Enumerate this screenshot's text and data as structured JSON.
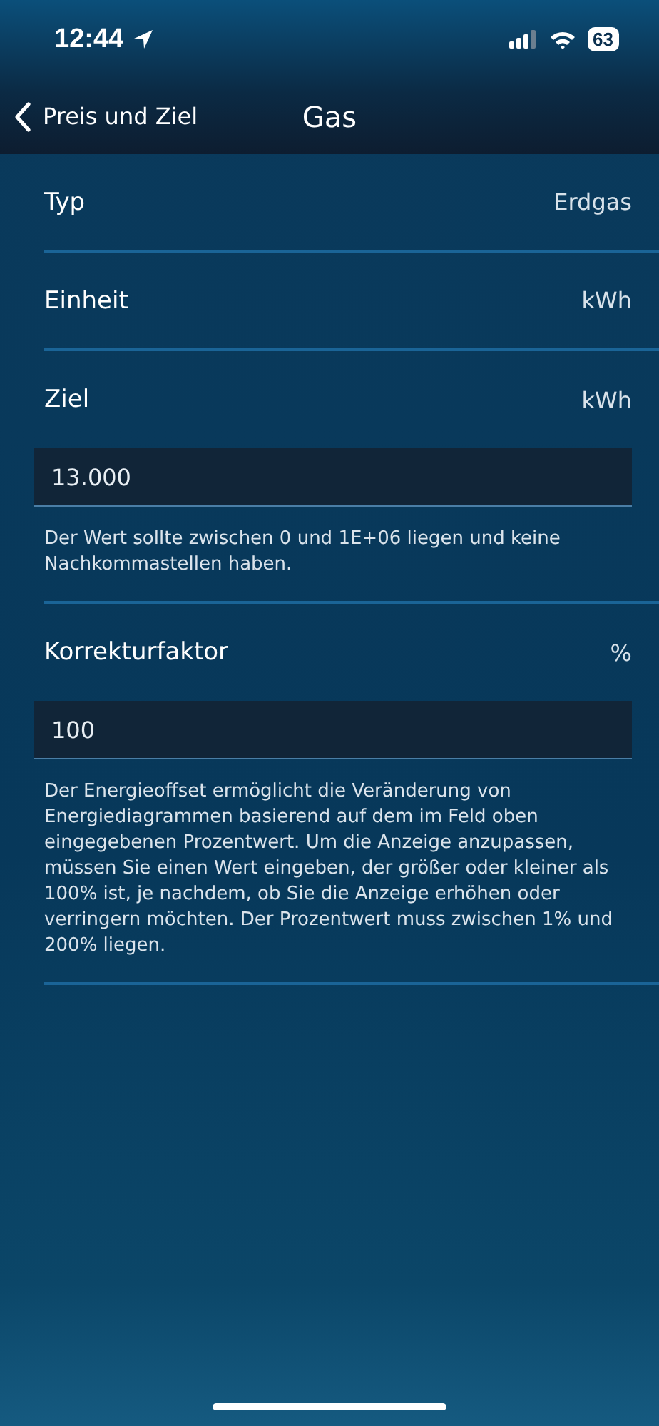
{
  "status_bar": {
    "time": "12:44",
    "battery": "63"
  },
  "nav": {
    "back": "Preis und Ziel",
    "title": "Gas"
  },
  "rows": [
    {
      "kind": "value",
      "label": "Typ",
      "value": "Erdgas"
    },
    {
      "kind": "value",
      "label": "Einheit",
      "value": "kWh"
    },
    {
      "kind": "input",
      "label": "Ziel",
      "unit": "kWh",
      "value": "13.000",
      "hint": "Der Wert sollte zwischen 0 und 1E+06 liegen und keine Nachkommastellen haben."
    },
    {
      "kind": "input",
      "label": "Korrekturfaktor",
      "unit": "%",
      "value": "100",
      "hint": "Der Energieoffset ermöglicht die Veränderung von Energiediagrammen basierend auf dem im Feld oben eingegebenen Prozentwert. Um die Anzeige anzupassen, müssen Sie einen Wert eingeben, der größer oder kleiner als 100% ist, je nachdem, ob Sie die Anzeige erhöhen oder verringern möchten. Der Prozentwert muss zwischen 1% und 200% liegen."
    }
  ]
}
